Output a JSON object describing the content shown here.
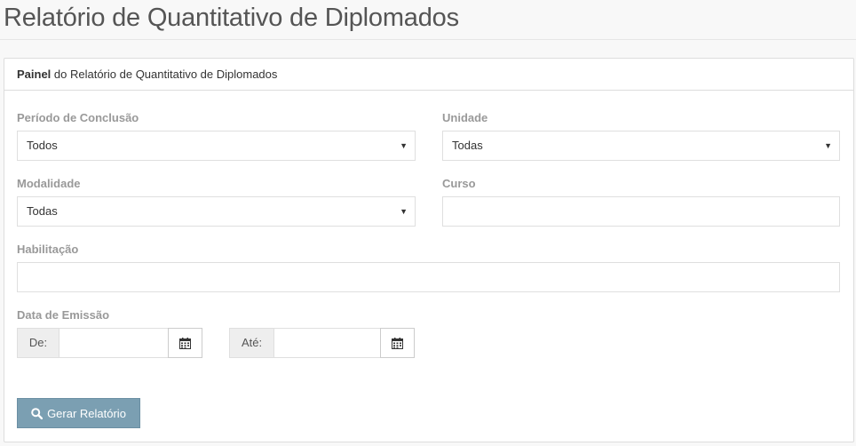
{
  "page": {
    "title": "Relatório de Quantitativo de Diplomados"
  },
  "panel": {
    "heading_bold": "Painel",
    "heading_rest": " do Relatório de Quantitativo de Diplomados"
  },
  "form": {
    "periodo": {
      "label": "Período de Conclusão",
      "value": "Todos"
    },
    "unidade": {
      "label": "Unidade",
      "value": "Todas"
    },
    "modalidade": {
      "label": "Modalidade",
      "value": "Todas"
    },
    "curso": {
      "label": "Curso",
      "value": ""
    },
    "habilitacao": {
      "label": "Habilitação",
      "value": ""
    },
    "data_emissao": {
      "label": "Data de Emissão",
      "de_label": "De:",
      "ate_label": "Até:",
      "de_value": "",
      "ate_value": ""
    }
  },
  "actions": {
    "gerar_label": "Gerar Relatório"
  },
  "icons": {
    "calendar": "calendar-icon",
    "search": "search-icon",
    "caret": "caret-down-icon"
  }
}
